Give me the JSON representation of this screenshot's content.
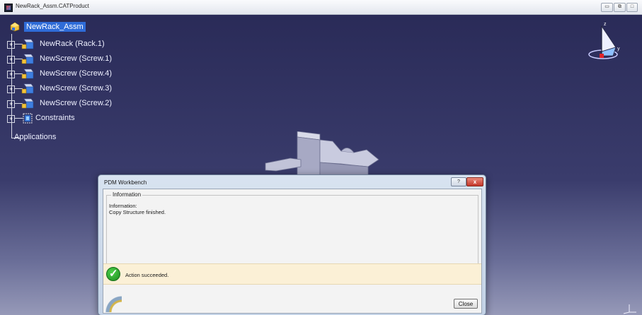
{
  "window": {
    "title": "NewRack_Assm.CATProduct",
    "controls": [
      "▭",
      "⧉",
      "□"
    ]
  },
  "tree": {
    "root": "NewRack_Assm",
    "items": [
      {
        "label": "NewRack (Rack.1)"
      },
      {
        "label": "NewScrew (Screw.1)"
      },
      {
        "label": "NewScrew (Screw.4)"
      },
      {
        "label": "NewScrew (Screw.3)"
      },
      {
        "label": "NewScrew (Screw.2)"
      },
      {
        "label": "Constraints"
      }
    ],
    "applications": "Applications"
  },
  "compass": {
    "z": "z",
    "y": "y"
  },
  "dialog": {
    "title": "PDM Workbench",
    "help_label": "?",
    "close_label": "x",
    "group_label": "Information",
    "message": "Information:\nCopy Structure finished.",
    "status_text": "Action succeeded.",
    "close_button": "Close"
  },
  "colors": {
    "tree_selection": "#2f6cd8",
    "status_bg": "#fbf0d6",
    "success_green": "#1b8a1f"
  }
}
